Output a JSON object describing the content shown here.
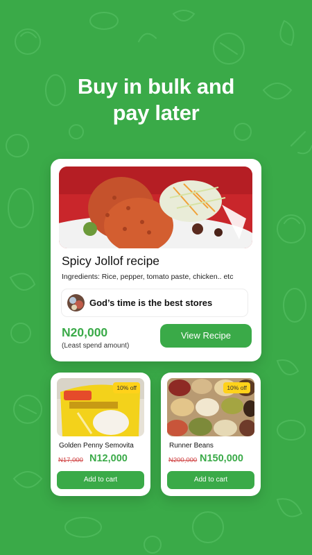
{
  "screen": {
    "headline_line1": "Buy in bulk and",
    "headline_line2": "pay later",
    "background_color": "#3aaa48"
  },
  "recipe_card": {
    "title": "Spicy Jollof recipe",
    "ingredients": "Ingredients: Rice, pepper, tomato paste, chicken.. etc",
    "store_name": "God’s time is the best stores",
    "price": "N20,000",
    "price_note": "(Least spend amount)",
    "button_label": "View Recipe"
  },
  "products": [
    {
      "name": "Golden Penny Semovita",
      "badge": "10% off",
      "old_price": "N17,000",
      "new_price": "N12,000",
      "button_label": "Add to cart"
    },
    {
      "name": "Runner Beans",
      "badge": "10% off",
      "old_price": "N200,000",
      "new_price": "N150,000",
      "button_label": "Add to cart"
    }
  ],
  "colors": {
    "accent_green": "#3aaa48",
    "badge_yellow": "#ffd21a",
    "strike_red": "#d04545"
  }
}
